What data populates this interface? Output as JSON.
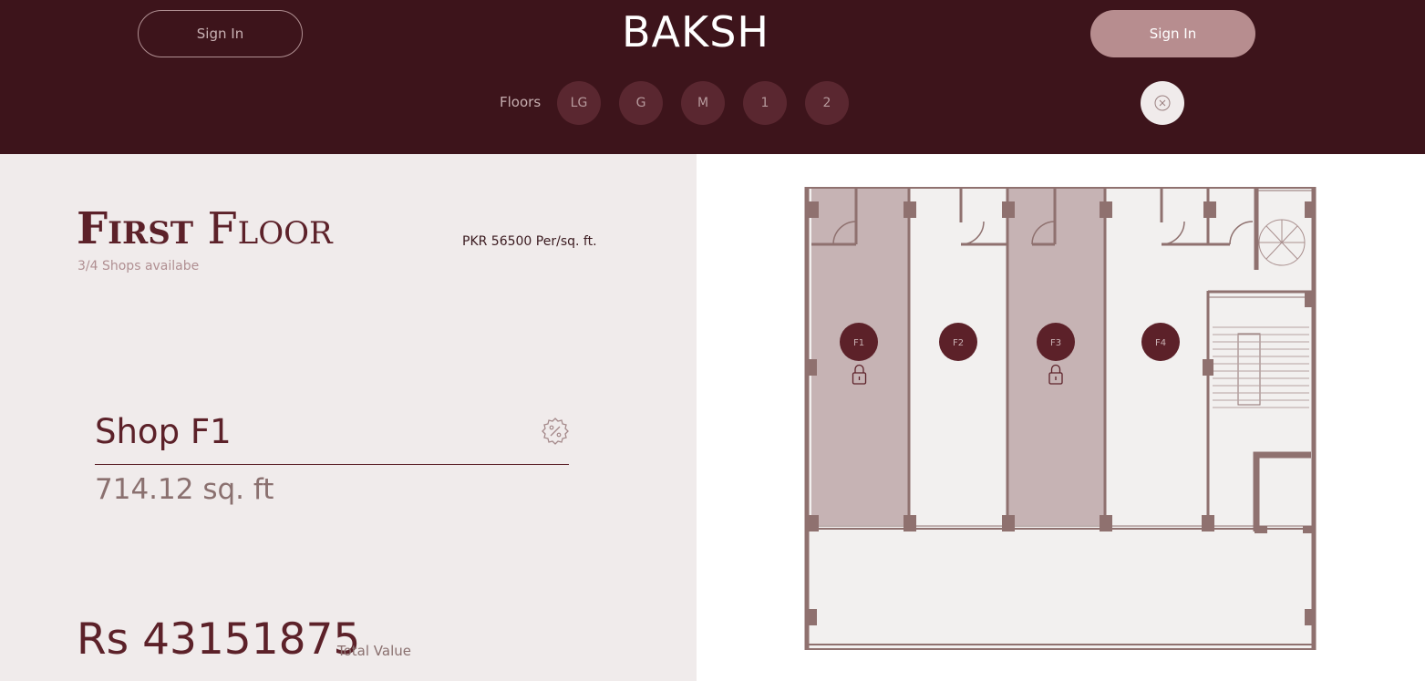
{
  "header": {
    "sign_in_left": "Sign In",
    "brand": "BAKSH",
    "sign_in_right": "Sign In",
    "floors_label": "Floors",
    "floors": [
      "LG",
      "G",
      "M",
      "1",
      "2"
    ]
  },
  "floor_info": {
    "title_bold": "First",
    "title_light": "Floor",
    "availability": "3/4 Shops availabe",
    "rate": "PKR 56500 Per/sq. ft."
  },
  "shop": {
    "name": "Shop F1",
    "area": "714.12 sq. ft",
    "price": "Rs 43151875",
    "price_label": "Total Value"
  },
  "plan": {
    "shops": [
      {
        "label": "F1",
        "locked": true
      },
      {
        "label": "F2",
        "locked": false
      },
      {
        "label": "F3",
        "locked": true
      },
      {
        "label": "F4",
        "locked": false
      }
    ]
  },
  "colors": {
    "header_bg": "#3d141b",
    "accent": "#5c2129",
    "button_fill": "#b78d8f",
    "locked_fill": "#c6b3b4",
    "wall": "#8f716f"
  }
}
